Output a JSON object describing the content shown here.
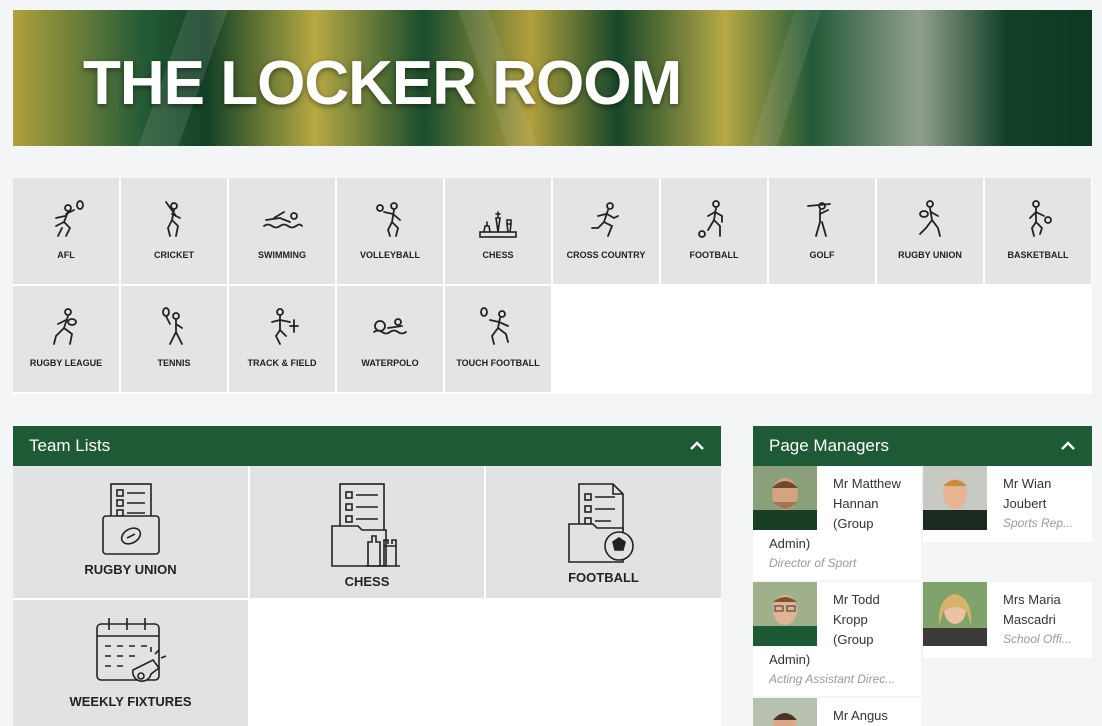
{
  "banner": {
    "title": "THE LOCKER ROOM"
  },
  "sports": [
    {
      "label": "AFL",
      "icon": "afl-player-icon"
    },
    {
      "label": "CRICKET",
      "icon": "cricket-batter-icon"
    },
    {
      "label": "SWIMMING",
      "icon": "swimmer-icon"
    },
    {
      "label": "VOLLEYBALL",
      "icon": "volleyball-player-icon"
    },
    {
      "label": "CHESS",
      "icon": "chess-pieces-icon"
    },
    {
      "label": "CROSS COUNTRY",
      "icon": "runner-icon"
    },
    {
      "label": "FOOTBALL",
      "icon": "football-player-icon"
    },
    {
      "label": "GOLF",
      "icon": "golfer-icon"
    },
    {
      "label": "RUGBY UNION",
      "icon": "rugby-union-player-icon"
    },
    {
      "label": "BASKETBALL",
      "icon": "basketball-player-icon"
    },
    {
      "label": "RUGBY LEAGUE",
      "icon": "rugby-league-player-icon"
    },
    {
      "label": "TENNIS",
      "icon": "tennis-player-icon"
    },
    {
      "label": "TRACK & FIELD",
      "icon": "hurdler-icon"
    },
    {
      "label": "WATERPOLO",
      "icon": "waterpolo-player-icon"
    },
    {
      "label": "TOUCH FOOTBALL",
      "icon": "touch-football-player-icon"
    }
  ],
  "team_lists": {
    "title": "Team Lists",
    "items": [
      {
        "label": "RUGBY UNION",
        "icon": "rugby-checklist-icon"
      },
      {
        "label": "CHESS",
        "icon": "chess-checklist-icon"
      },
      {
        "label": "FOOTBALL",
        "icon": "football-checklist-icon"
      },
      {
        "label": "WEEKLY FIXTURES",
        "icon": "calendar-whistle-icon"
      }
    ]
  },
  "page_managers": {
    "title": "Page Managers",
    "people": [
      {
        "name_lines": [
          "Mr Matthew",
          "Hannan",
          "(Group",
          "Admin)"
        ],
        "role": "Director of Sport"
      },
      {
        "name_lines": [
          "Mr Wian",
          "Joubert"
        ],
        "role": "Sports Rep..."
      },
      {
        "name_lines": [
          "Mr Todd",
          "Kropp",
          "(Group",
          "Admin)"
        ],
        "role": "Acting Assistant Direc..."
      },
      {
        "name_lines": [
          "Mrs Maria",
          "Mascadri"
        ],
        "role": "School Offi..."
      },
      {
        "name_lines": [
          "Mr Angus"
        ],
        "role": ""
      }
    ]
  },
  "colors": {
    "panel_header": "#1e5a36",
    "tile": "#e4e4e4"
  }
}
